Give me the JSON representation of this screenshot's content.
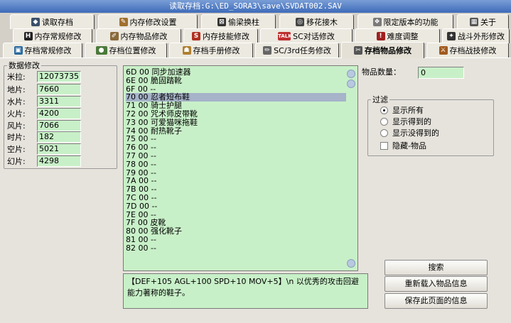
{
  "window": {
    "title": "读取存档:G:\\ED_SORA3\\save\\SVDAT002.SAV"
  },
  "tabs_row1": [
    {
      "label": "读取存档",
      "icon": "diamond-icon"
    },
    {
      "label": "内存修改设置",
      "icon": "tools-icon"
    },
    {
      "label": "偷梁换柱",
      "icon": "swap-icon"
    },
    {
      "label": "移花接木",
      "icon": "graft-icon"
    },
    {
      "label": "限定版本的功能",
      "icon": "shield-icon"
    },
    {
      "label": "关于",
      "icon": "grid-icon"
    }
  ],
  "tabs_row2": [
    {
      "label": "内存常规修改",
      "icon": "hp-icon"
    },
    {
      "label": "内存物品修改",
      "icon": "pen-icon"
    },
    {
      "label": "内存技能修改",
      "icon": "skill-icon"
    },
    {
      "label": "SC对话修改",
      "icon": "talk-icon"
    },
    {
      "label": "难度调整",
      "icon": "difficulty-icon"
    },
    {
      "label": "战斗外形修改",
      "icon": "battle-icon"
    }
  ],
  "tabs_row3": [
    {
      "label": "存档常规修改",
      "icon": "disk-icon"
    },
    {
      "label": "存档位置修改",
      "icon": "position-icon"
    },
    {
      "label": "存档手册修改",
      "icon": "book-icon"
    },
    {
      "label": "SC/3rd任务修改",
      "icon": "pencil-icon"
    },
    {
      "label": "存档物品修改",
      "icon": "scissors-icon",
      "active": true
    },
    {
      "label": "存档战技修改",
      "icon": "tech-icon"
    }
  ],
  "stats": {
    "legend": "数据修改",
    "rows": [
      {
        "label": "米拉:",
        "value": "12073735"
      },
      {
        "label": "地片:",
        "value": "7660"
      },
      {
        "label": "水片:",
        "value": "3311"
      },
      {
        "label": "火片:",
        "value": "4200"
      },
      {
        "label": "风片:",
        "value": "7066"
      },
      {
        "label": "时片:",
        "value": "182"
      },
      {
        "label": "空片:",
        "value": "5021"
      },
      {
        "label": "幻片:",
        "value": "4298"
      }
    ]
  },
  "item_list": {
    "items": [
      "6D 00 同步加速器",
      "6E 00 脆固踏靴",
      "6F 00 --",
      "70 00 忍者短布鞋",
      "71 00 骑士护腿",
      "72 00 咒术师皮带靴",
      "73 00 可爱猫咪拖鞋",
      "74 00 耐热靴子",
      "75 00 --",
      "76 00 --",
      "77 00 --",
      "78 00 --",
      "79 00 --",
      "7A 00 --",
      "7B 00 --",
      "7C 00 --",
      "7D 00 --",
      "7E 00 --",
      "7F 00 皮靴",
      "80 00 强化靴子",
      "81 00 --",
      "82 00 --"
    ],
    "selected_index": 3
  },
  "description": "【DEF+105 AGL+100 SPD+10 MOV+5】\\n  以优秀的攻击回避能力著称的鞋子。",
  "quantity": {
    "label": "物品数量：",
    "value": "0"
  },
  "filter": {
    "legend": "过滤",
    "options": [
      {
        "label": "显示所有",
        "checked": true
      },
      {
        "label": "显示得到的",
        "checked": false
      },
      {
        "label": "显示没得到的",
        "checked": false
      }
    ],
    "hide_label": "隐藏-物品"
  },
  "buttons": {
    "search": "搜索",
    "reload": "重新载入物品信息",
    "save": "保存此页面的信息"
  }
}
